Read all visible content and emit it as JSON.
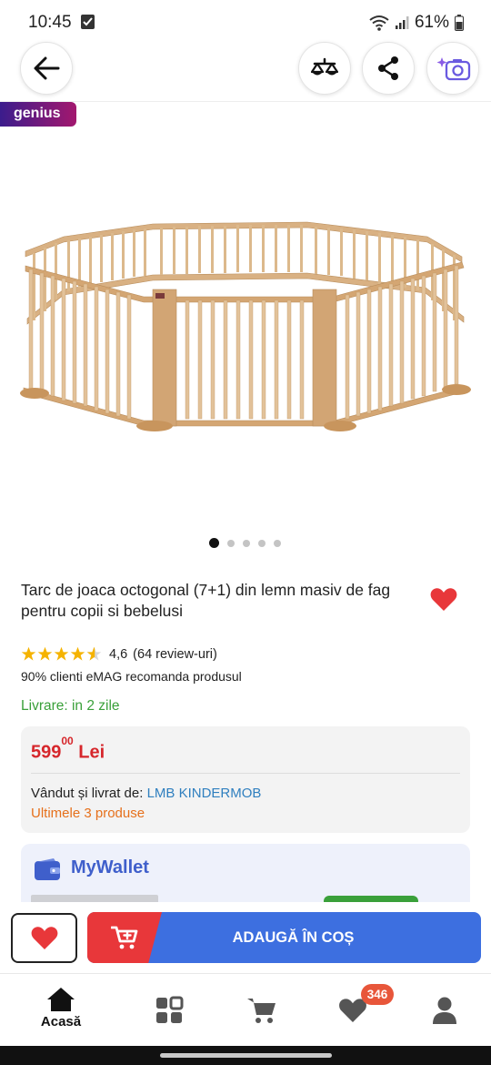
{
  "status_bar": {
    "time": "10:45",
    "battery": "61%"
  },
  "header": {
    "back_icon": "arrow-left-icon",
    "compare_icon": "balance-scale-icon",
    "share_icon": "share-icon",
    "camera_icon": "camera-sparkle-icon"
  },
  "genius_badge": "genius",
  "gallery": {
    "total_images": 5,
    "active_index": 0
  },
  "product": {
    "title": "Tarc de joaca octogonal (7+1) din lemn masiv de fag pentru copii si bebelusi",
    "rating": {
      "stars": 4.6,
      "value": "4,6",
      "reviews": "(64 review-uri)"
    },
    "recommendation": "90% clienti eMAG recomanda produsul",
    "delivery": "Livrare: in 2 zile",
    "price": {
      "integer": "599",
      "decimals": "00",
      "currency": "Lei"
    },
    "seller": {
      "label": "Vândut și livrat de:",
      "name": "LMB KINDERMOB"
    },
    "stock_note": "Ultimele 3 produse"
  },
  "wallet": {
    "title": "MyWallet"
  },
  "actions": {
    "add_to_cart": "ADAUGĂ ÎN COȘ"
  },
  "bottom_nav": {
    "items": [
      {
        "id": "home",
        "label": "Acasă",
        "icon": "home-icon",
        "active": true
      },
      {
        "id": "categories",
        "label": "",
        "icon": "grid-icon"
      },
      {
        "id": "cart",
        "label": "",
        "icon": "cart-icon"
      },
      {
        "id": "favorites",
        "label": "",
        "icon": "heart-icon",
        "badge": "346"
      },
      {
        "id": "account",
        "label": "",
        "icon": "user-icon"
      }
    ]
  },
  "colors": {
    "price": "#d6262b",
    "delivery": "#3aa03a",
    "seller_link": "#2f7fbf",
    "stock_note": "#e6701b",
    "cart_button": "#3d6fe0",
    "cart_icon_bg": "#e8373a",
    "heart": "#e8373a",
    "wallet_title": "#3f5fcb"
  }
}
